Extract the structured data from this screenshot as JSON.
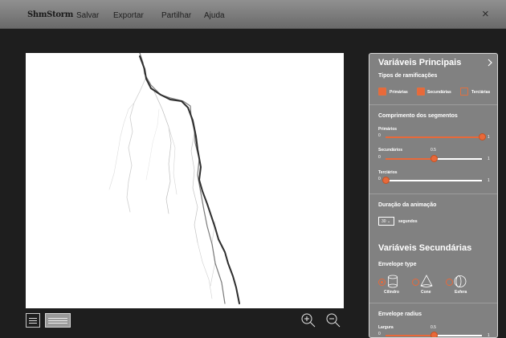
{
  "menubar": {
    "brand": "ShmStorm",
    "items": [
      "Salvar",
      "Exportar",
      "Partilhar",
      "Ajuda"
    ],
    "close_label": "×"
  },
  "panel": {
    "main_title": "Variáveis Principais",
    "branch_types": {
      "title": "Tipos de ramificações",
      "options": [
        {
          "label": "Primárias",
          "color": "#e8693a",
          "filled": true
        },
        {
          "label": "Secundárias",
          "color": "#e8693a",
          "filled": true
        },
        {
          "label": "Terciárias",
          "color": "#e8693a",
          "filled": false
        }
      ]
    },
    "segment_length": {
      "title": "Comprimento dos segmentos",
      "sliders": [
        {
          "label": "Primários",
          "min": "0",
          "max": "1",
          "value": 1.0,
          "value_label": ""
        },
        {
          "label": "Secundários",
          "min": "0",
          "max": "1",
          "value": 0.5,
          "value_label": "0.5"
        },
        {
          "label": "Terciários",
          "min": "0",
          "max": "1",
          "value": 0.0,
          "value_label": ""
        }
      ]
    },
    "animation": {
      "title": "Duração da animação",
      "select_value": "30",
      "unit": "segundos"
    },
    "secondary_title": "Variáveis Secundárias",
    "envelope_type": {
      "title": "Envelope type",
      "options": [
        {
          "label": "Cilindro",
          "selected": true
        },
        {
          "label": "Cone",
          "selected": false
        },
        {
          "label": "Esfera",
          "selected": false
        }
      ]
    },
    "envelope_radius": {
      "title": "Envelope radius",
      "slider": {
        "label": "Largura",
        "min": "0",
        "max": "1",
        "value": 0.5,
        "value_label": "0.5"
      }
    }
  },
  "colors": {
    "accent": "#e8693a",
    "panel": "#818181",
    "background": "#1e1e1e"
  }
}
